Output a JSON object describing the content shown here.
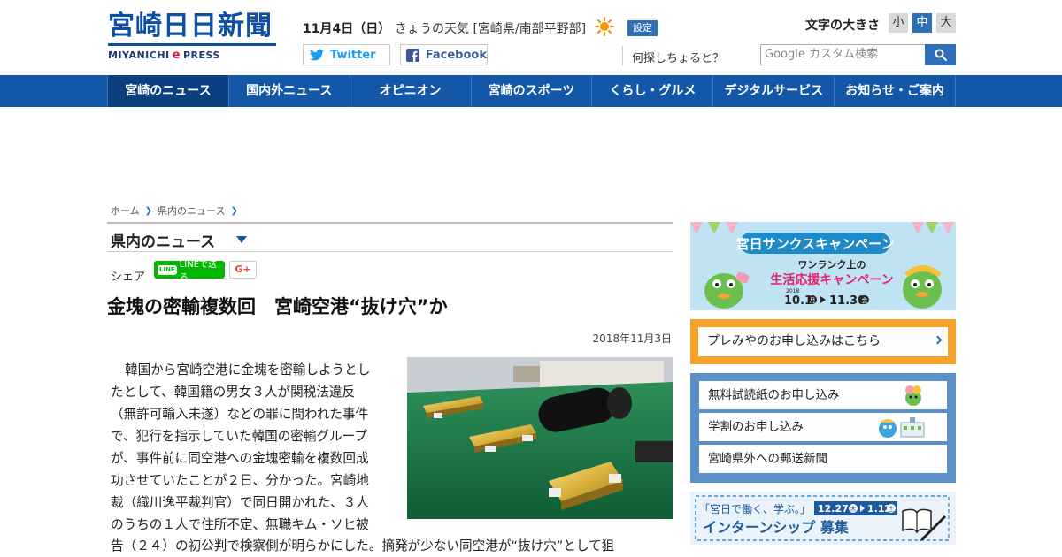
{
  "header": {
    "logo_main": "宮崎日日新聞",
    "logo_sub_left": "MIYANICHI",
    "logo_sub_e": "e",
    "logo_sub_right": "PRESS",
    "date": "11月4日（日）",
    "weather": "きょうの天気 [宮崎県/南部平野部]",
    "weather_icon": "sun-icon",
    "settings_label": "設定",
    "twitter_label": "Twitter",
    "facebook_label": "Facebook",
    "font_size_label": "文字の大きさ",
    "font_small": "小",
    "font_medium": "中",
    "font_large": "大",
    "search_question": "何探しちょると？",
    "search_placeholder": "Google カスタム検索"
  },
  "nav": {
    "items": [
      "宮崎のニュース",
      "国内外ニュース",
      "オピニオン",
      "宮崎のスポーツ",
      "くらし・グルメ",
      "デジタルサービス",
      "お知らせ・ご案内"
    ]
  },
  "breadcrumb": {
    "home": "ホーム",
    "current": "県内のニュース"
  },
  "section": {
    "title": "県内のニュース"
  },
  "share": {
    "label": "シェア",
    "line_badge": "LINE",
    "line_label": "LINEで送る",
    "gplus_label": "G+"
  },
  "article": {
    "headline": "金塊の密輸複数回　宮崎空港“抜け穴”か",
    "date": "2018年11月3日",
    "body_lines": [
      "韓国から宮崎空港に金塊を密輸しようとし",
      "たとして、韓国籍の男女３人が関税法違反",
      "（無許可輸入未遂）などの罪に問われた事件",
      "で、犯行を指示していた韓国の密輸グループ",
      "が、事件前に同空港への金塊密輸を複数回成",
      "功させていたことが２日、分かった。宮崎地",
      "裁（織川逸平裁判官）で同日開かれた、３人",
      "のうちの１人で住所不定、無職キム・ソヒ被"
    ],
    "body_last": "告（２４）の初公判で検察側が明らかにした。摘発が少ない同空港が“抜け穴”として狙"
  },
  "sidebar": {
    "banner_title": "宮日サンクスキャンペーン",
    "banner_line1": "ワンランク上の",
    "banner_line2": "生活応援キャンペーン",
    "banner_year": "2018",
    "banner_date_from": "10.1",
    "banner_from_day": "月",
    "banner_date_to": "11.30",
    "banner_to_day": "金",
    "premium_link": "プレみやのお申し込みはこちら",
    "links": [
      "無料試読紙のお申し込み",
      "学割のお申し込み",
      "宮崎県外への郵送新聞"
    ],
    "intern_tagline": "「宮日で働く、学ぶ。」",
    "intern_dates": "12.27",
    "intern_day_from": "木",
    "intern_date_to": "1.12",
    "intern_day_to": "土",
    "intern_title": "インターンシップ 募集"
  },
  "colors": {
    "brand_blue": "#1357a8",
    "accent_blue": "#2f6fb8",
    "line_green": "#00b900",
    "orange": "#f5a12a",
    "sidebar_blue": "#5a8fc8"
  }
}
